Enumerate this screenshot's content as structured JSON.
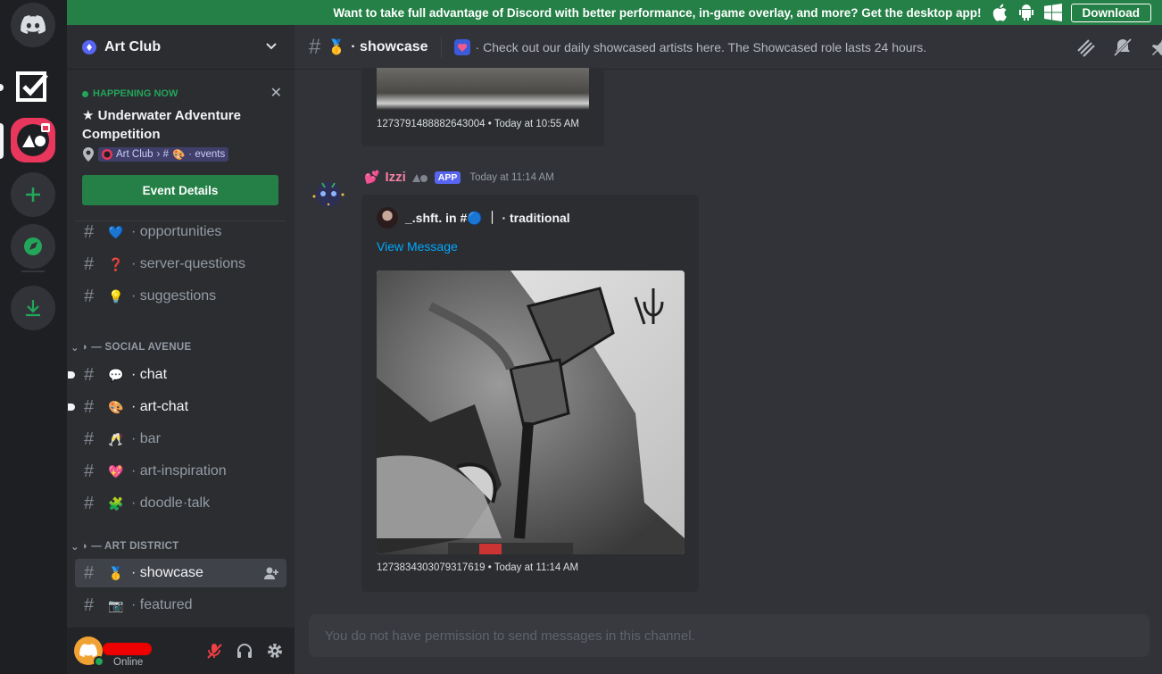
{
  "banner": {
    "text": "Want to take full advantage of Discord with better performance, in-game overlay, and more? Get the desktop app!",
    "download_label": "Download",
    "icons": [
      "apple-icon",
      "android-icon",
      "windows-icon"
    ]
  },
  "server": {
    "name": "Art Club"
  },
  "event": {
    "status": "HAPPENING NOW",
    "title": "★ Underwater Adventure Competition",
    "location_server": "Art Club",
    "location_channel": "· events",
    "button_label": "Event Details"
  },
  "channels": [
    {
      "emoji": "💙",
      "label": "· opportunities",
      "state": "muted"
    },
    {
      "emoji": "❓",
      "label": "· server-questions",
      "state": "muted"
    },
    {
      "emoji": "💡",
      "label": "· suggestions",
      "state": "muted"
    }
  ],
  "category_social": "— SOCIAL AVENUE",
  "social_channels": [
    {
      "emoji": "💬",
      "label": "· chat",
      "state": "unread"
    },
    {
      "emoji": "🎨",
      "label": "· art-chat",
      "state": "unread"
    },
    {
      "emoji": "🥂",
      "label": "· bar",
      "state": "muted"
    },
    {
      "emoji": "💖",
      "label": "· art-inspiration",
      "state": "muted"
    },
    {
      "emoji": "🧩",
      "label": "· doodle·talk",
      "state": "muted"
    }
  ],
  "category_art": "— ART DISTRICT",
  "art_channels": [
    {
      "emoji": "🥇",
      "label": "· showcase",
      "state": "selected"
    },
    {
      "emoji": "📷",
      "label": "· featured",
      "state": "muted"
    }
  ],
  "user": {
    "status": "Online"
  },
  "topbar": {
    "channel_emoji": "🥇",
    "channel_name": "· showcase",
    "topic": "· Check out our daily showcased artists here. The Showcased role lasts 24 hours."
  },
  "prev_message": {
    "meta": "1273791488882643004 • Today at 10:55 AM"
  },
  "message": {
    "author": "Izzi",
    "badge": "APP",
    "time": "Today at 11:14 AM",
    "embed_author": "_.shft. in #🔵 ｜ · traditional",
    "embed_link": "View Message",
    "embed_meta": "1273834303079317619 • Today at 11:14 AM"
  },
  "composer": {
    "placeholder": "You do not have permission to send messages in this channel."
  },
  "colors": {
    "brand": "#5865f2",
    "success": "#248046",
    "link": "#00a8fc",
    "author": "#f47fa3"
  }
}
